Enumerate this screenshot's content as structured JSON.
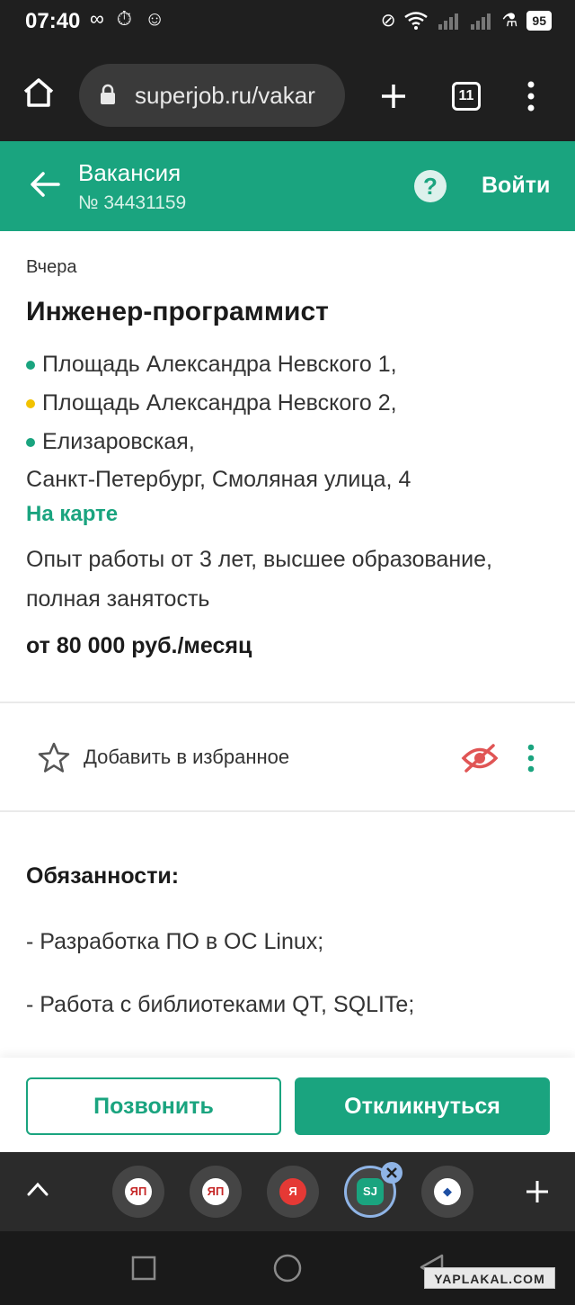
{
  "status_bar": {
    "time": "07:40",
    "left_icons": [
      "infinity-icon",
      "timer-icon",
      "face-mask-icon"
    ],
    "right_icons": [
      "do-not-disturb-icon",
      "wifi-icon",
      "signal-icon",
      "signal-icon",
      "lab-icon"
    ],
    "battery": "95"
  },
  "browser": {
    "url": "superjob.ru/vakar",
    "tab_count": "11"
  },
  "header": {
    "title": "Вакансия",
    "vacancy_number": "№ 34431159",
    "login_label": "Войти",
    "help_glyph": "?"
  },
  "vacancy": {
    "date": "Вчера",
    "title": "Инженер-программист",
    "metro": [
      {
        "name": "Площадь Александра Невского 1,",
        "color": "#1aa47f"
      },
      {
        "name": "Площадь Александра Невского 2,",
        "color": "#f2c200"
      },
      {
        "name": "Елизаровская,",
        "color": "#1aa47f"
      }
    ],
    "address": "Санкт-Петербург, Смоляная улица, 4",
    "map_link": "На карте",
    "requirements": "Опыт работы от 3 лет, высшее образование, полная занятость",
    "salary": "от 80 000 руб./месяц"
  },
  "favorites": {
    "label": "Добавить в избранное"
  },
  "duties": {
    "heading": "Обязанности:",
    "items": [
      "- Разработка ПО в ОС Linux;",
      "- Работа с библиотеками QT, SQLITe;"
    ]
  },
  "actions": {
    "call_label": "Позвонить",
    "apply_label": "Откликнуться"
  },
  "tab_strip": {
    "tabs": [
      {
        "glyph": "ЯП",
        "color": "#c62828"
      },
      {
        "glyph": "ЯП",
        "color": "#c62828"
      },
      {
        "glyph": "Я",
        "color": "#e53935"
      },
      {
        "glyph": "SJ",
        "color": "#1aa47f"
      },
      {
        "glyph": "◆",
        "color": "#1e4fa3"
      }
    ]
  },
  "watermark": "YAPLAKAL.COM",
  "colors": {
    "accent": "#1aa47f",
    "hide_icon": "#e05555"
  }
}
